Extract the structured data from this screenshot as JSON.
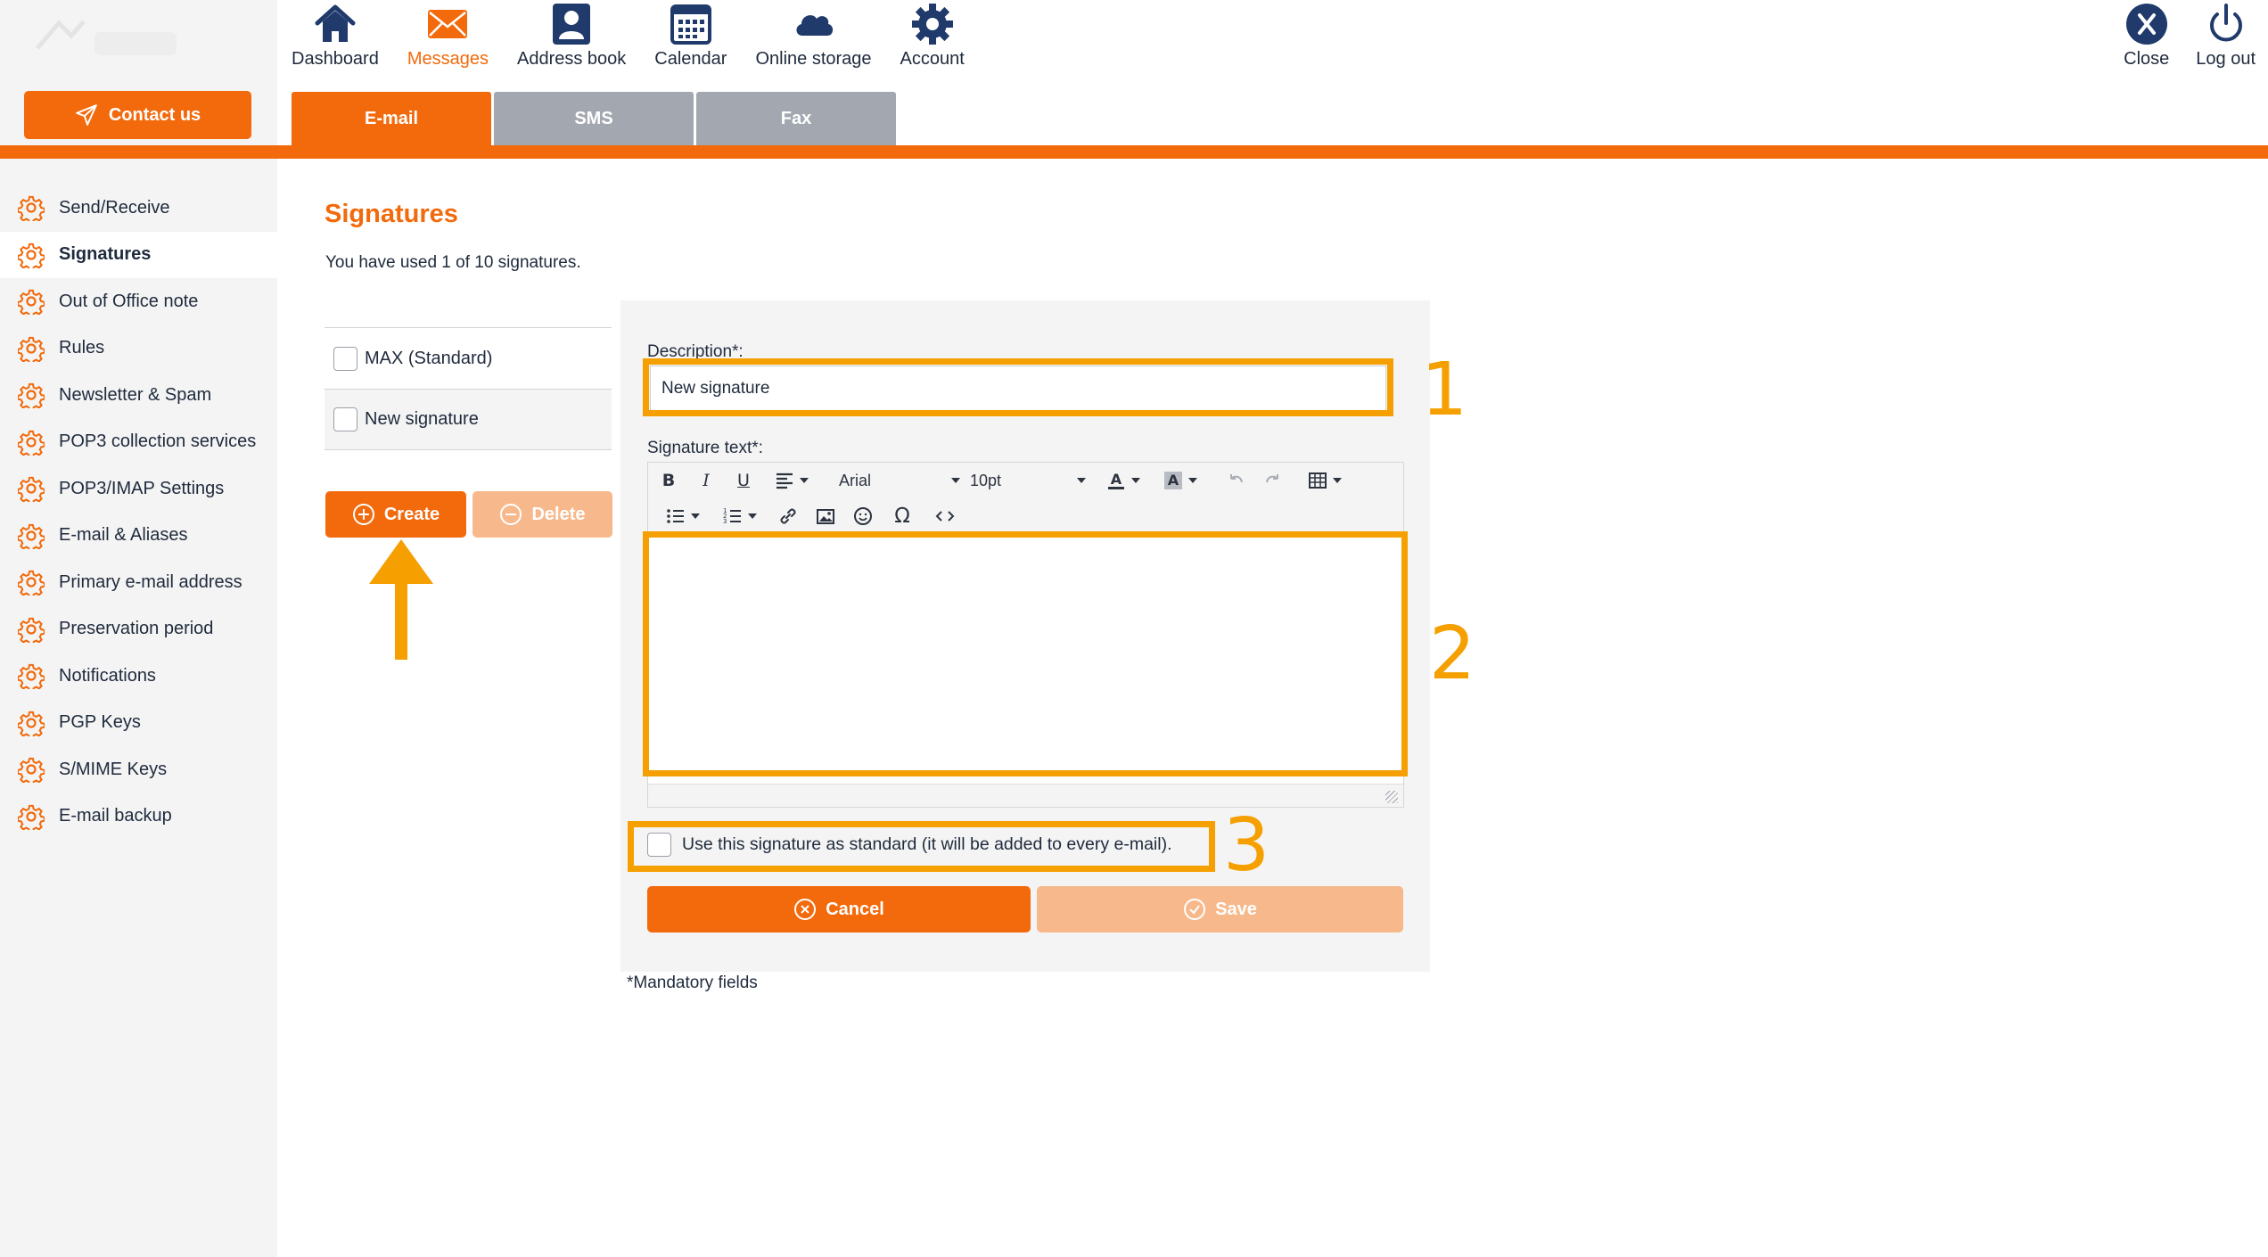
{
  "top_nav": {
    "items": [
      {
        "label": "Dashboard",
        "icon": "home-icon"
      },
      {
        "label": "Messages",
        "icon": "envelope-icon",
        "active": true
      },
      {
        "label": "Address book",
        "icon": "contact-card-icon"
      },
      {
        "label": "Calendar",
        "icon": "calendar-icon"
      },
      {
        "label": "Online storage",
        "icon": "cloud-icon"
      },
      {
        "label": "Account",
        "icon": "gear-icon"
      }
    ],
    "right": [
      {
        "label": "Close",
        "icon": "close-circle-icon"
      },
      {
        "label": "Log out",
        "icon": "power-icon"
      }
    ]
  },
  "contact_button": "Contact us",
  "tabs": [
    {
      "label": "E-mail",
      "active": true
    },
    {
      "label": "SMS"
    },
    {
      "label": "Fax"
    }
  ],
  "sidebar": {
    "items": [
      {
        "label": "Send/Receive"
      },
      {
        "label": "Signatures",
        "active": true
      },
      {
        "label": "Out of Office note"
      },
      {
        "label": "Rules"
      },
      {
        "label": "Newsletter & Spam"
      },
      {
        "label": "POP3 collection services"
      },
      {
        "label": "POP3/IMAP Settings"
      },
      {
        "label": "E-mail & Aliases"
      },
      {
        "label": "Primary e-mail address"
      },
      {
        "label": "Preservation period"
      },
      {
        "label": "Notifications"
      },
      {
        "label": "PGP Keys"
      },
      {
        "label": "S/MIME Keys"
      },
      {
        "label": "E-mail backup"
      }
    ]
  },
  "main": {
    "title": "Signatures",
    "usage": "You have used 1 of 10 signatures.",
    "signatures": [
      {
        "name": "MAX (Standard)",
        "checked": false
      },
      {
        "name": "New signature",
        "checked": false,
        "selected": true
      }
    ],
    "create_label": "Create",
    "delete_label": "Delete",
    "form": {
      "description_label": "Description*:",
      "description_value": "New signature",
      "signature_text_label": "Signature text*:",
      "font_family": "Arial",
      "font_size": "10pt",
      "editor_content": "",
      "standard_checkbox_label": "Use this signature as standard (it will be added to every e-mail).",
      "standard_checked": false,
      "cancel_label": "Cancel",
      "save_label": "Save"
    },
    "mandatory_note": "*Mandatory fields"
  },
  "annotations": [
    "1",
    "2",
    "3"
  ],
  "colors": {
    "accent": "#f26a0c",
    "accent_disabled": "#f7b98c",
    "tab_inactive": "#a3a8b0",
    "nav_icon": "#1f3a6b",
    "highlight": "#f5a000",
    "sidebar_bg": "#f4f4f4"
  }
}
